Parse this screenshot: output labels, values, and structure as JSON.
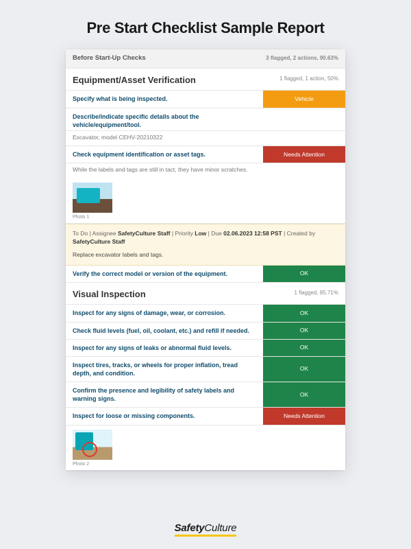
{
  "page_title": "Pre Start Checklist Sample Report",
  "brand": {
    "bold": "Safety",
    "light": "Culture"
  },
  "header": {
    "title": "Before Start-Up Checks",
    "meta": "3 flagged, 2 actions, 90.63%"
  },
  "sections": [
    {
      "title": "Equipment/Asset Verification",
      "meta": "1 flagged, 1 action, 50%",
      "items": [
        {
          "q": "Specify what is being inspected.",
          "pill": "Vehicle",
          "pill_class": "orange"
        },
        {
          "q": "Describe/indicate specific details about the vehicle/equipment/tool.",
          "note": "Excavator, model CEHV-20210322"
        },
        {
          "q": "Check equipment identification or asset tags.",
          "pill": "Needs Attention",
          "pill_class": "red",
          "note_after": "While the labels and tags are still in tact, they have minor scratches.",
          "photo": {
            "caption": "Photo 1",
            "variant": "excavator1"
          },
          "action": {
            "line": [
              "To Do  |  Assignee ",
              {
                "b": "SafetyCulture Staff"
              },
              "  |  Priority ",
              {
                "b": "Low"
              },
              "  |  Due ",
              {
                "b": "02.06.2023 12:58 PST"
              },
              "  |  Created by ",
              {
                "b": "SafetyCulture Staff"
              }
            ],
            "task": "Replace excavator labels and tags."
          }
        },
        {
          "q": "Verify the correct model or version of the equipment.",
          "pill": "OK",
          "pill_class": "green"
        }
      ]
    },
    {
      "title": "Visual Inspection",
      "meta": "1 flagged, 85.71%",
      "items": [
        {
          "q": "Inspect for any signs of damage, wear, or corrosion.",
          "pill": "OK",
          "pill_class": "green"
        },
        {
          "q": "Check fluid levels (fuel, oil, coolant, etc.) and refill if needed.",
          "pill": "OK",
          "pill_class": "green"
        },
        {
          "q": "Inspect for any signs of leaks or abnormal fluid levels.",
          "pill": "OK",
          "pill_class": "green"
        },
        {
          "q": "Inspect tires, tracks, or wheels for proper inflation, tread depth, and condition.",
          "pill": "OK",
          "pill_class": "green"
        },
        {
          "q": "Confirm the presence and legibility of safety labels and warning signs.",
          "pill": "OK",
          "pill_class": "green"
        },
        {
          "q": "Inspect for loose or missing components.",
          "pill": "Needs Attention",
          "pill_class": "red",
          "photo": {
            "caption": "Photo 2",
            "variant": "excavator2"
          }
        }
      ]
    }
  ]
}
